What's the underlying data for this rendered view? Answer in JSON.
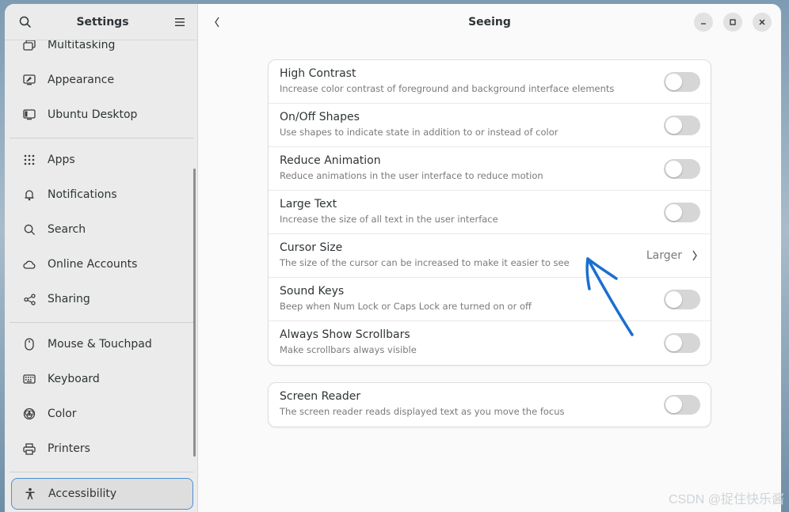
{
  "sidebar": {
    "title": "Settings",
    "items": [
      {
        "label": "Multitasking",
        "icon": "multitasking-icon"
      },
      {
        "label": "Appearance",
        "icon": "appearance-icon"
      },
      {
        "label": "Ubuntu Desktop",
        "icon": "ubuntu-desktop-icon"
      },
      {
        "label": "Apps",
        "icon": "apps-grid-icon"
      },
      {
        "label": "Notifications",
        "icon": "bell-icon"
      },
      {
        "label": "Search",
        "icon": "search-icon"
      },
      {
        "label": "Online Accounts",
        "icon": "cloud-icon"
      },
      {
        "label": "Sharing",
        "icon": "share-icon"
      },
      {
        "label": "Mouse & Touchpad",
        "icon": "mouse-icon"
      },
      {
        "label": "Keyboard",
        "icon": "keyboard-icon"
      },
      {
        "label": "Color",
        "icon": "color-icon"
      },
      {
        "label": "Printers",
        "icon": "printer-icon"
      },
      {
        "label": "Accessibility",
        "icon": "accessibility-icon",
        "selected": true
      }
    ]
  },
  "main": {
    "title": "Seeing",
    "rows": [
      {
        "title": "High Contrast",
        "subtitle": "Increase color contrast of foreground and background interface elements",
        "control": "toggle",
        "enabled": false
      },
      {
        "title": "On/Off Shapes",
        "subtitle": "Use shapes to indicate state in addition to or instead of color",
        "control": "toggle",
        "enabled": false
      },
      {
        "title": "Reduce Animation",
        "subtitle": "Reduce animations in the user interface to reduce motion",
        "control": "toggle",
        "enabled": false
      },
      {
        "title": "Large Text",
        "subtitle": "Increase the size of all text in the user interface",
        "control": "toggle",
        "enabled": false
      },
      {
        "title": "Cursor Size",
        "subtitle": "The size of the cursor can be increased to make it easier to see",
        "control": "value",
        "value": "Larger"
      },
      {
        "title": "Sound Keys",
        "subtitle": "Beep when Num Lock or Caps Lock are turned on or off",
        "control": "toggle",
        "enabled": false
      },
      {
        "title": "Always Show Scrollbars",
        "subtitle": "Make scrollbars always visible",
        "control": "toggle",
        "enabled": false
      }
    ],
    "screen_reader": {
      "title": "Screen Reader",
      "subtitle": "The screen reader reads displayed text as you move the focus",
      "control": "toggle",
      "enabled": false
    }
  },
  "watermark": "CSDN @捉住快乐酱",
  "colors": {
    "accent": "#4a90d9",
    "annotation": "#1a6fd1"
  }
}
